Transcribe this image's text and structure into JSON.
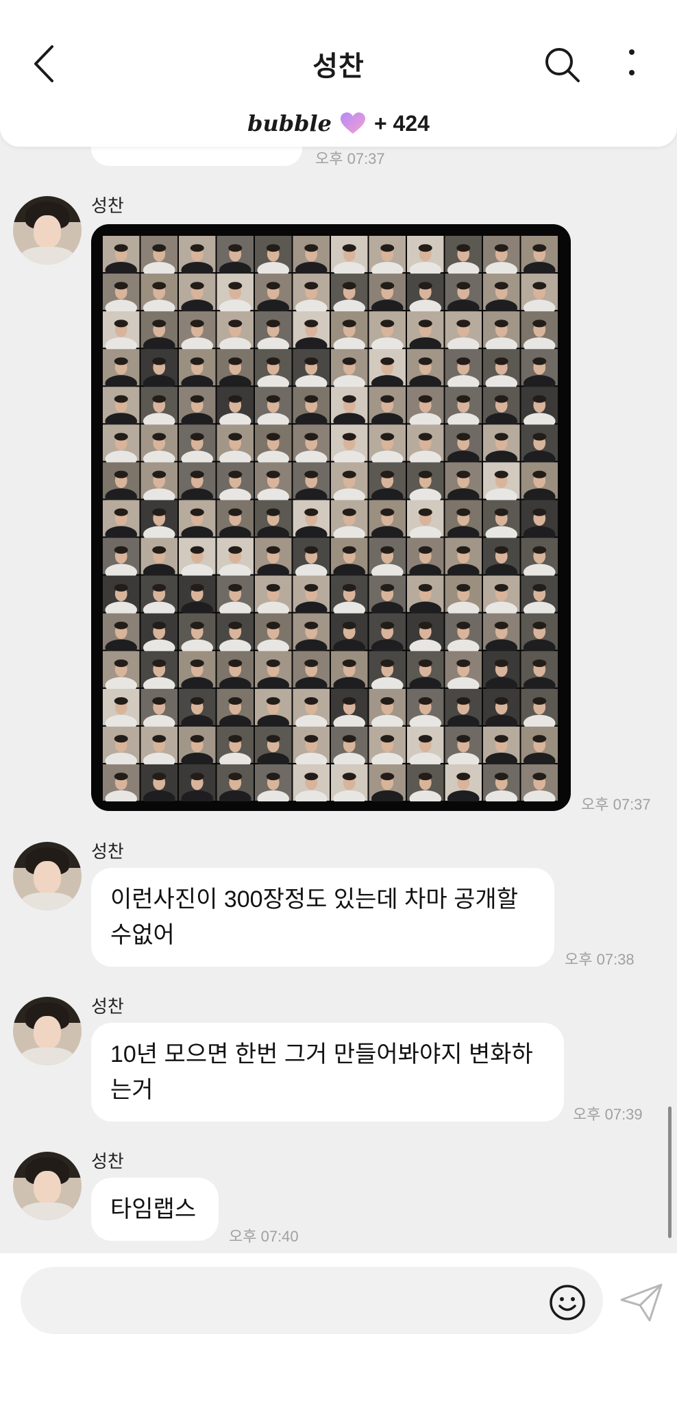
{
  "header": {
    "title": "성찬",
    "bubble_logo": "bubble",
    "bubble_count": "+ 424",
    "icons": [
      "chevron-left-icon",
      "search-icon",
      "more-vertical-icon",
      "heart-icon"
    ],
    "heart_colors": [
      "#c58cf5",
      "#f29fd2"
    ]
  },
  "messages": [
    {
      "type": "text-partial",
      "time": "오후 07:37"
    },
    {
      "sender": "성찬",
      "type": "image",
      "description": "photo grid",
      "time": "오후 07:37"
    },
    {
      "sender": "성찬",
      "type": "text",
      "lines": [
        "이런사진이 300장정도 있는데 차마 공개할",
        "수없어"
      ],
      "time": "오후 07:38"
    },
    {
      "sender": "성찬",
      "type": "text",
      "lines": [
        "10년 모으면 한번 그거 만들어봐야지 변화하",
        "는거"
      ],
      "time": "오후 07:39"
    },
    {
      "sender": "성찬",
      "type": "text",
      "lines": [
        "타임랩스"
      ],
      "time": "오후 07:40"
    }
  ],
  "composer": {
    "placeholder": "",
    "icons": [
      "emoji-icon",
      "send-icon"
    ]
  }
}
